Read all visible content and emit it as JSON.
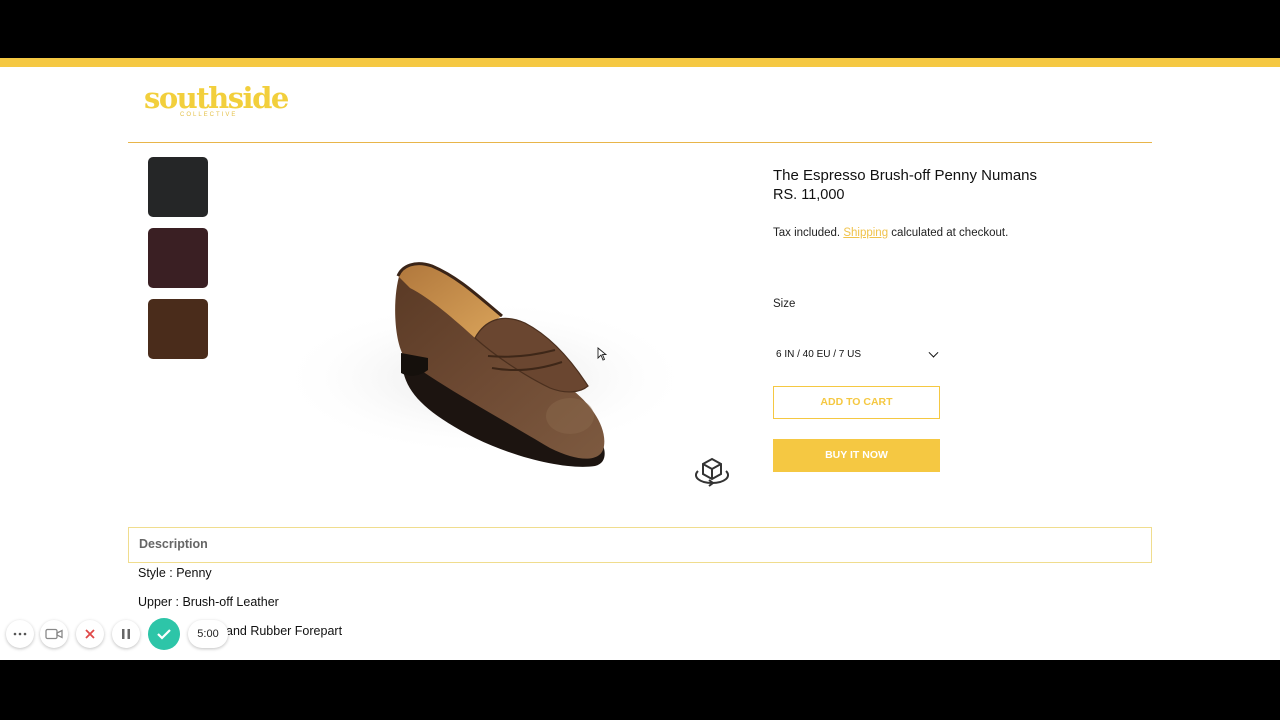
{
  "brand": {
    "name": "southside",
    "tagline": "COLLECTIVE",
    "accent": "#f5c842"
  },
  "swatches": [
    {
      "name": "black",
      "color": "#252627"
    },
    {
      "name": "burgundy",
      "color": "#3a1f23"
    },
    {
      "name": "espresso",
      "color": "#4a2c1b"
    }
  ],
  "product": {
    "title": "The Espresso Brush-off Penny Numans",
    "price": "RS. 11,000",
    "tax_prefix": "Tax included.",
    "tax_link": "Shipping",
    "tax_suffix": "calculated at checkout."
  },
  "size": {
    "label": "Size",
    "selected": "6 IN / 40 EU / 7 US"
  },
  "buttons": {
    "add_to_cart": "ADD TO CART",
    "buy_now": "BUY IT NOW"
  },
  "description": {
    "title": "Description",
    "lines": [
      "Style : Penny",
      "Upper : Brush-off Leather",
      "and Rubber Forepart"
    ]
  },
  "recorder": {
    "timer": "5:00",
    "icons": [
      "more-icon",
      "camera-icon",
      "close-icon",
      "pause-icon",
      "check-icon"
    ]
  }
}
